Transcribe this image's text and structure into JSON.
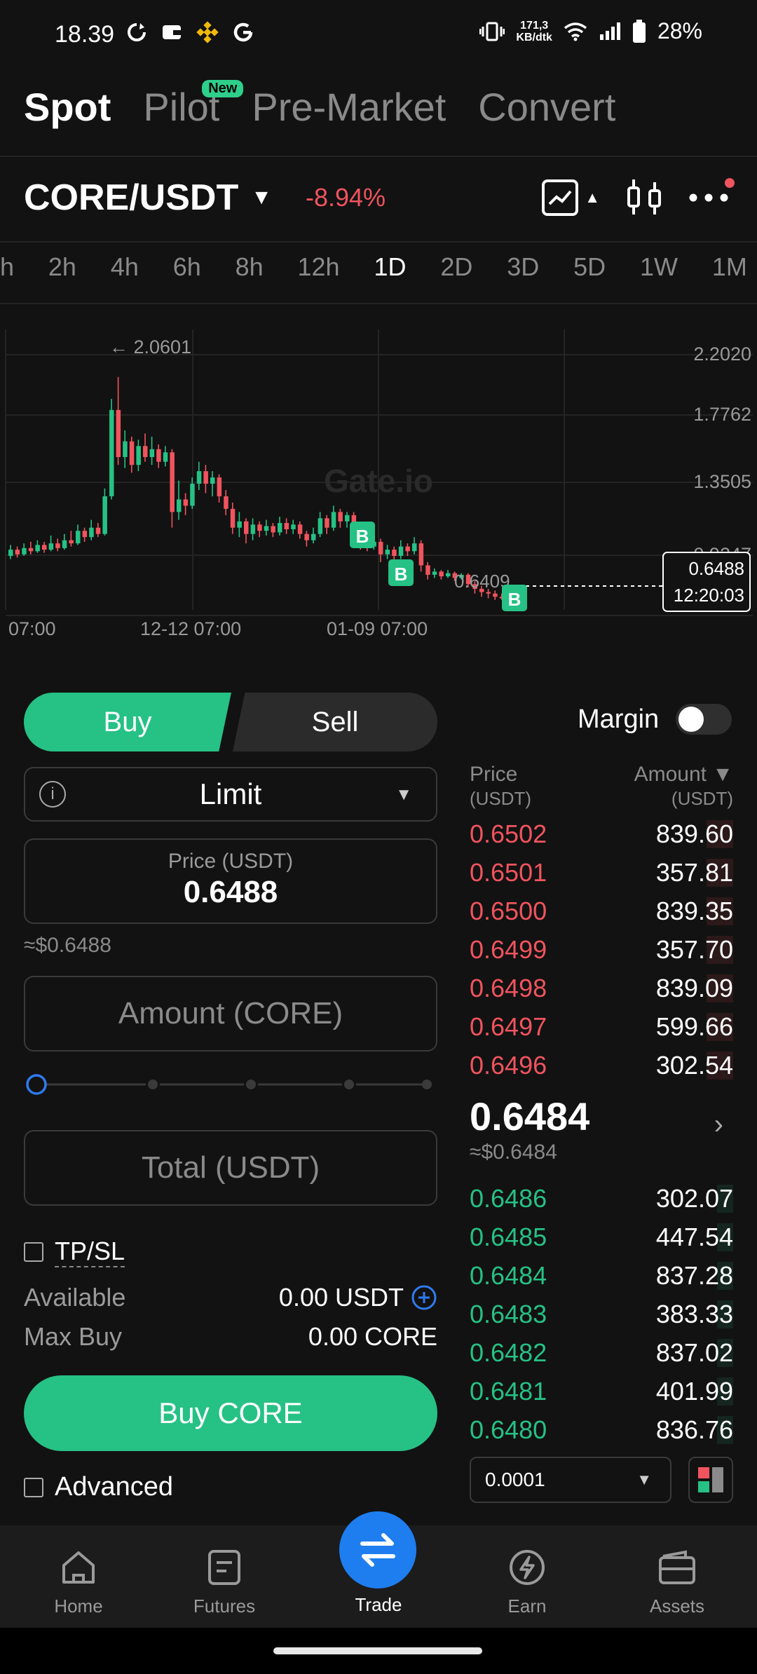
{
  "status_bar": {
    "time": "18.39",
    "net_speed_value": "171,3",
    "net_speed_unit": "KB/dtk",
    "battery": "28%"
  },
  "top_tabs": [
    {
      "label": "Spot",
      "active": true
    },
    {
      "label": "Pilot",
      "badge": "New"
    },
    {
      "label": "Pre-Market"
    },
    {
      "label": "Convert"
    }
  ],
  "pair": {
    "name": "CORE/USDT",
    "change": "-8.94%"
  },
  "timeframes": [
    "h",
    "2h",
    "4h",
    "6h",
    "8h",
    "12h",
    "1D",
    "2D",
    "3D",
    "5D",
    "1W",
    "1M"
  ],
  "active_timeframe": "1D",
  "chart": {
    "high_marker": "← 2.0601",
    "low_marker": "0.6409",
    "watermark": "Gate.io",
    "y_ticks": [
      "2.2020",
      "1.7762",
      "1.3505",
      "0.9247"
    ],
    "x_ticks": [
      "07:00",
      "12-12 07:00",
      "01-09 07:00"
    ],
    "current_price": "0.6488",
    "countdown": "12:20:03",
    "buy_marker": "B"
  },
  "order_form": {
    "buy_label": "Buy",
    "sell_label": "Sell",
    "margin_label": "Margin",
    "order_type": "Limit",
    "price_label": "Price (USDT)",
    "price_value": "0.6488",
    "approx_price": "≈$0.6488",
    "amount_placeholder": "Amount (CORE)",
    "total_placeholder": "Total (USDT)",
    "tpsl_label": "TP/SL",
    "available_label": "Available",
    "available_value": "0.00 USDT",
    "max_buy_label": "Max Buy",
    "max_buy_value": "0.00 CORE",
    "buy_button": "Buy CORE",
    "advanced_label": "Advanced"
  },
  "order_book": {
    "price_header": "Price",
    "price_unit": "(USDT)",
    "amount_header": "Amount ▼",
    "amount_unit": "(USDT)",
    "asks": [
      {
        "price": "0.6502",
        "amount": "839.60",
        "depth": 0.1
      },
      {
        "price": "0.6501",
        "amount": "357.81",
        "depth": 0.1
      },
      {
        "price": "0.6500",
        "amount": "839.35",
        "depth": 0.1
      },
      {
        "price": "0.6499",
        "amount": "357.70",
        "depth": 0.1
      },
      {
        "price": "0.6498",
        "amount": "839.09",
        "depth": 0.1
      },
      {
        "price": "0.6497",
        "amount": "599.66",
        "depth": 0.1
      },
      {
        "price": "0.6496",
        "amount": "302.54",
        "depth": 0.1
      }
    ],
    "mid_price": "0.6484",
    "mid_usd": "≈$0.6484",
    "bids": [
      {
        "price": "0.6486",
        "amount": "302.07",
        "depth": 0.06
      },
      {
        "price": "0.6485",
        "amount": "447.54",
        "depth": 0.06
      },
      {
        "price": "0.6484",
        "amount": "837.28",
        "depth": 0.06
      },
      {
        "price": "0.6483",
        "amount": "383.33",
        "depth": 0.06
      },
      {
        "price": "0.6482",
        "amount": "837.02",
        "depth": 0.06
      },
      {
        "price": "0.6481",
        "amount": "401.99",
        "depth": 0.06
      },
      {
        "price": "0.6480",
        "amount": "836.76",
        "depth": 0.06
      }
    ],
    "precision": "0.0001"
  },
  "bottom_nav": [
    {
      "label": "Home",
      "icon": "home-icon"
    },
    {
      "label": "Futures",
      "icon": "futures-icon"
    },
    {
      "label": "Trade",
      "icon": "trade-icon",
      "active": true
    },
    {
      "label": "Earn",
      "icon": "earn-icon"
    },
    {
      "label": "Assets",
      "icon": "wallet-icon"
    }
  ],
  "colors": {
    "up": "#26c185",
    "down": "#f0545e",
    "accent": "#1e7ef0",
    "background": "#121212"
  }
}
